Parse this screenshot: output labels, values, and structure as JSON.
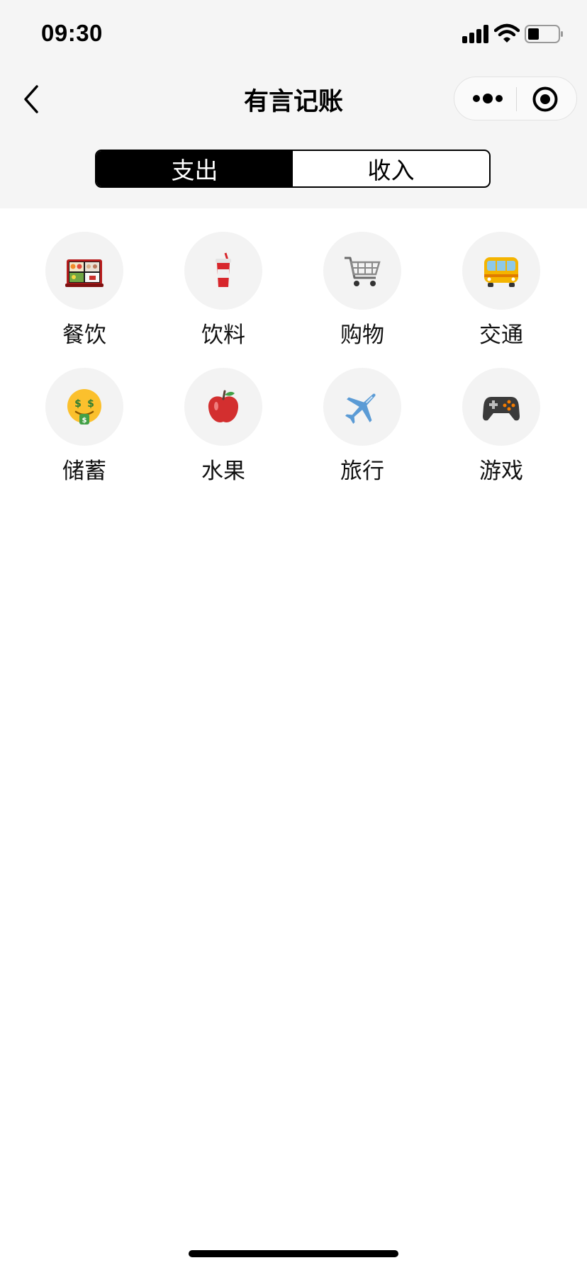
{
  "status_bar": {
    "time": "09:30"
  },
  "nav": {
    "title": "有言记账",
    "back_icon": "chevron-left-icon",
    "more_icon": "more-icon",
    "close_icon": "record-icon"
  },
  "segment": {
    "tabs": [
      {
        "label": "支出",
        "active": true
      },
      {
        "label": "收入",
        "active": false
      }
    ]
  },
  "categories": [
    {
      "label": "餐饮",
      "icon": "bento-icon"
    },
    {
      "label": "饮料",
      "icon": "drink-cup-icon"
    },
    {
      "label": "购物",
      "icon": "shopping-cart-icon"
    },
    {
      "label": "交通",
      "icon": "bus-icon"
    },
    {
      "label": "储蓄",
      "icon": "money-face-icon"
    },
    {
      "label": "水果",
      "icon": "apple-icon"
    },
    {
      "label": "旅行",
      "icon": "airplane-icon"
    },
    {
      "label": "游戏",
      "icon": "gamepad-icon"
    }
  ],
  "colors": {
    "header_bg": "#f5f5f5",
    "active_tab_bg": "#000000",
    "circle_bg": "#f3f3f3"
  }
}
